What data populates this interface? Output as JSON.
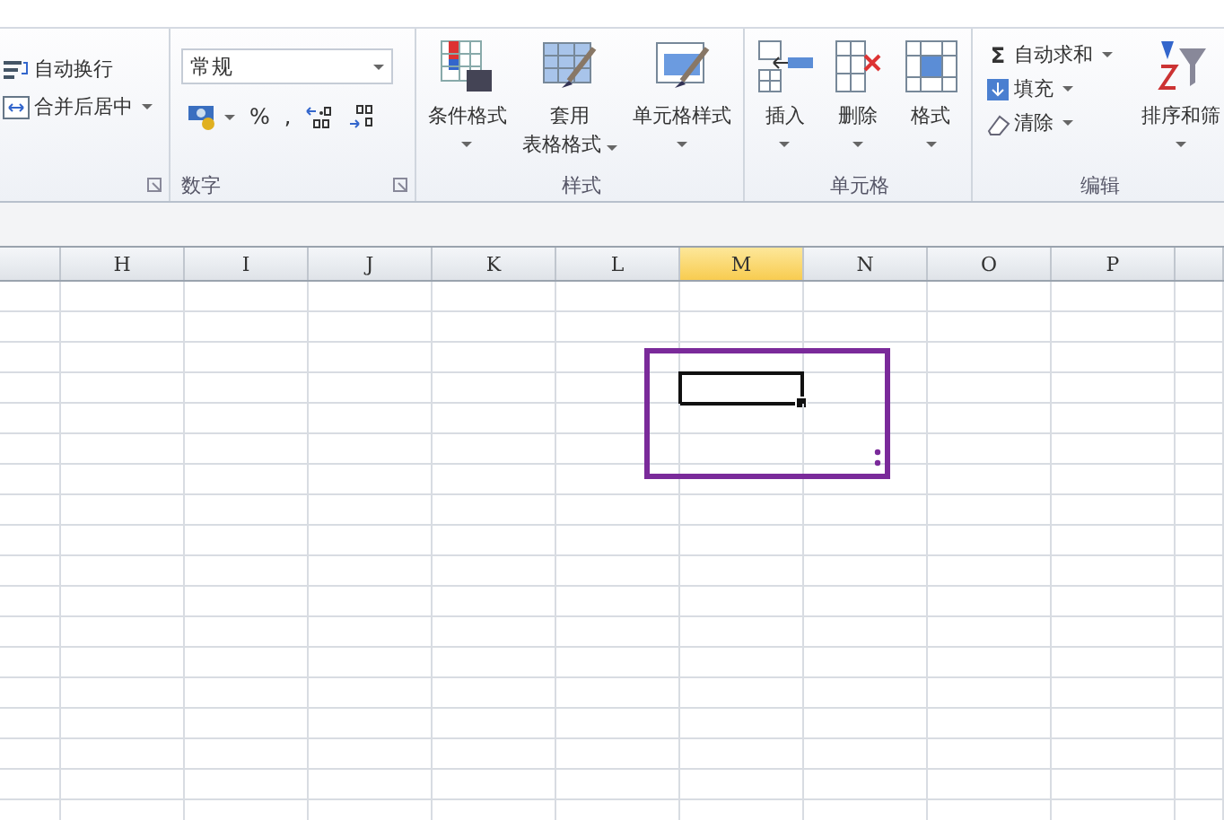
{
  "alignment": {
    "buttons": [
      {
        "label": "自动换行",
        "dropdown": false
      },
      {
        "label": "合并后居中",
        "dropdown": true
      }
    ]
  },
  "number": {
    "label": "数字",
    "format_value": "常规",
    "buttons": [
      {
        "kind": "icon",
        "dropdown": true
      },
      {
        "kind": "text",
        "text": "%"
      },
      {
        "kind": "text",
        "text": ","
      },
      {
        "kind": "icon",
        "dropdown": false
      },
      {
        "kind": "icon",
        "dropdown": false
      }
    ]
  },
  "styles": {
    "label": "样式",
    "buttons": [
      {
        "lines": [
          "条件格式"
        ]
      },
      {
        "lines": [
          "套用",
          "表格格式"
        ]
      },
      {
        "lines": [
          "单元格样式"
        ]
      }
    ]
  },
  "cells": {
    "label": "单元格",
    "buttons": [
      {
        "lines": [
          "插入"
        ]
      },
      {
        "lines": [
          "删除"
        ]
      },
      {
        "lines": [
          "格式"
        ]
      }
    ]
  },
  "editing": {
    "label": "编辑",
    "buttons": [
      {
        "symbol": "Σ",
        "label": "自动求和"
      },
      {
        "label": "填充"
      },
      {
        "label": "清除"
      }
    ],
    "sort_label": "排序和筛"
  },
  "sheet": {
    "columns": [
      {
        "label": "H",
        "selected": false
      },
      {
        "label": "I",
        "selected": false
      },
      {
        "label": "J",
        "selected": false
      },
      {
        "label": "K",
        "selected": false
      },
      {
        "label": "L",
        "selected": false
      },
      {
        "label": "M",
        "selected": true
      },
      {
        "label": "N",
        "selected": false
      },
      {
        "label": "O",
        "selected": false
      },
      {
        "label": "P",
        "selected": false
      }
    ]
  }
}
